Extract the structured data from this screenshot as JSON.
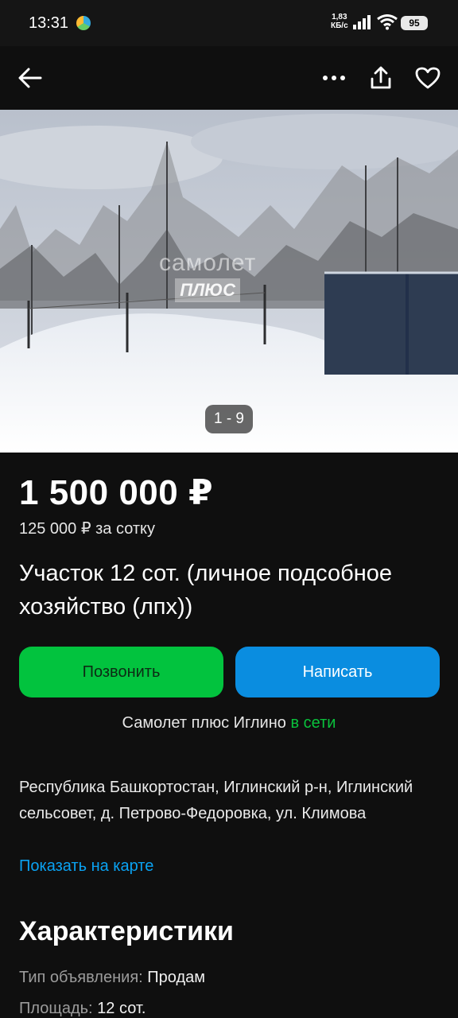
{
  "status_bar": {
    "time": "13:31",
    "speed_value": "1,83",
    "speed_unit": "КБ/с",
    "battery": "95",
    "icons": [
      "app-notification-icon",
      "signal-icon",
      "wifi-icon",
      "battery-icon"
    ]
  },
  "toolbar": {
    "icons": [
      "back-arrow-icon",
      "more-dots-icon",
      "share-icon",
      "heart-icon"
    ]
  },
  "photo": {
    "watermark_top": "самолет",
    "watermark_bottom": "ПЛЮС",
    "counter": "1 - 9"
  },
  "listing": {
    "price": "1 500 000 ₽",
    "price_per_unit": "125 000 ₽ за сотку",
    "title": "Участок 12 сот. (личное подсобное хозяйство (лпх))"
  },
  "actions": {
    "call_label": "Позвонить",
    "write_label": "Написать"
  },
  "seller": {
    "name": "Самолет плюс Иглино",
    "status": "в сети"
  },
  "location": {
    "address": "Республика Башкортостан, Иглинский р-н, Иглинский сельсовет, д. Петрово-Федоровка, ул. Климова",
    "map_link": "Показать на карте"
  },
  "characteristics": {
    "title": "Характеристики",
    "rows": [
      {
        "label": "Тип объявления:",
        "value": "Продам"
      },
      {
        "label": "Площадь:",
        "value": "12 сот."
      }
    ]
  },
  "colors": {
    "background": "#0f0f0f",
    "call_button": "#02c33e",
    "write_button": "#0a8de0",
    "online": "#0ac23c",
    "link": "#0aa2f2"
  }
}
